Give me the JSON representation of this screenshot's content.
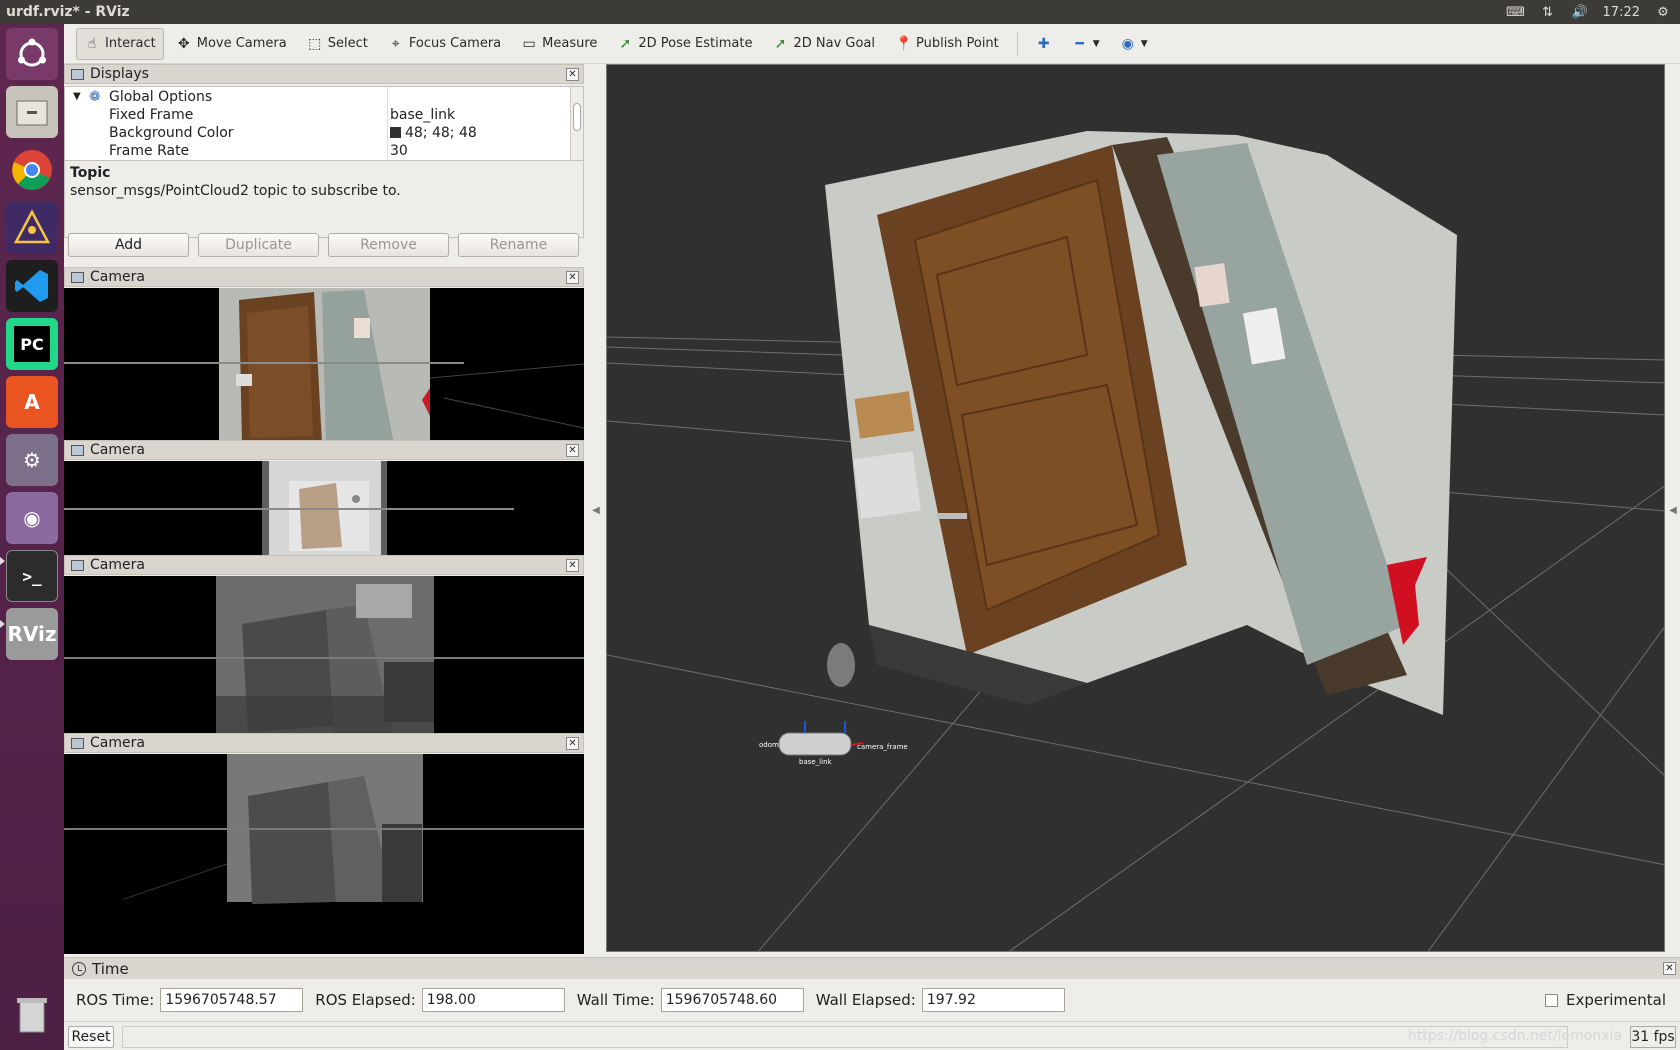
{
  "window": {
    "title": "urdf.rviz* - RViz"
  },
  "tray": {
    "time": "17:22",
    "icons": [
      "keyboard-icon",
      "network-icon",
      "volume-icon",
      "gear-icon"
    ]
  },
  "toolbar": {
    "interact": "Interact",
    "move_camera": "Move Camera",
    "select": "Select",
    "focus_camera": "Focus Camera",
    "measure": "Measure",
    "pose_estimate": "2D Pose Estimate",
    "nav_goal": "2D Nav Goal",
    "publish_point": "Publish Point"
  },
  "displays": {
    "title": "Displays",
    "group": "Global Options",
    "rows": [
      {
        "name": "Fixed Frame",
        "value": "base_link"
      },
      {
        "name": "Background Color",
        "value": "48; 48; 48",
        "swatch": "#303030"
      },
      {
        "name": "Frame Rate",
        "value": "30"
      }
    ]
  },
  "topic": {
    "heading": "Topic",
    "description": "sensor_msgs/PointCloud2 topic to subscribe to."
  },
  "buttons": {
    "add": "Add",
    "duplicate": "Duplicate",
    "remove": "Remove",
    "rename": "Rename"
  },
  "cameras": [
    "Camera",
    "Camera",
    "Camera",
    "Camera"
  ],
  "time": {
    "title": "Time",
    "ros_time_label": "ROS Time:",
    "ros_time": "1596705748.57",
    "ros_elapsed_label": "ROS Elapsed:",
    "ros_elapsed": "198.00",
    "wall_time_label": "Wall Time:",
    "wall_time": "1596705748.60",
    "wall_elapsed_label": "Wall Elapsed:",
    "wall_elapsed": "197.92",
    "experimental": "Experimental"
  },
  "status": {
    "reset": "Reset",
    "fps": "31 fps",
    "watermark": "https://blog.csdn.net/lemonxia"
  },
  "scene": {
    "base_label": "base_link",
    "frame_label": "camera_frame"
  },
  "colors": {
    "launcher": "#5e2750",
    "viewport_bg": "#303030",
    "door": "#6b4221",
    "wall": "#c9cbc7"
  }
}
